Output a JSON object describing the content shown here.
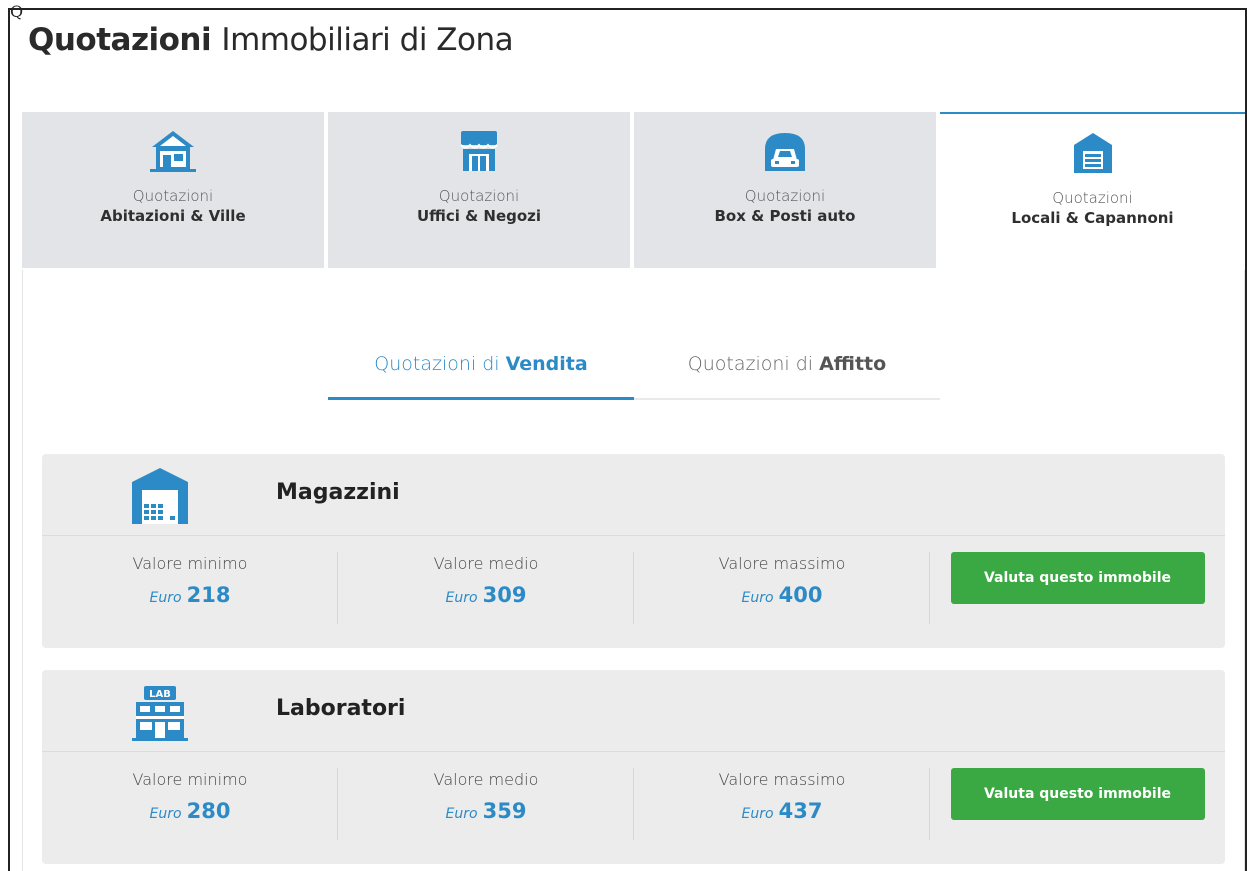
{
  "colors": {
    "accent": "#2c8ac6",
    "button": "#3aa843",
    "tab_inactive": "#e2e4e7",
    "card_bg": "#ececec"
  },
  "page": {
    "title_bold": "Quotazioni",
    "title_light": "Immobiliari di Zona"
  },
  "corner_char": "Q",
  "tabs": [
    {
      "icon": "house-icon",
      "line1": "Quotazioni",
      "line2": "Abitazioni & Ville",
      "active": false
    },
    {
      "icon": "shop-icon",
      "line1": "Quotazioni",
      "line2": "Uffici & Negozi",
      "active": false
    },
    {
      "icon": "garage-car-icon",
      "line1": "Quotazioni",
      "line2": "Box & Posti auto",
      "active": false
    },
    {
      "icon": "warehouse-icon",
      "line1": "Quotazioni",
      "line2": "Locali & Capannoni",
      "active": true
    }
  ],
  "subtabs": [
    {
      "prefix": "Quotazioni di",
      "bold": "Vendita",
      "active": true
    },
    {
      "prefix": "Quotazioni di",
      "bold": "Affitto",
      "active": false
    }
  ],
  "cards": [
    {
      "icon": "warehouse-icon",
      "title": "Magazzini",
      "min_label": "Valore minimo",
      "min_unit": "Euro",
      "min_value": "218",
      "avg_label": "Valore medio",
      "avg_unit": "Euro",
      "avg_value": "309",
      "max_label": "Valore massimo",
      "max_unit": "Euro",
      "max_value": "400",
      "button": "Valuta questo immobile"
    },
    {
      "icon": "lab-building-icon",
      "title": "Laboratori",
      "min_label": "Valore minimo",
      "min_unit": "Euro",
      "min_value": "280",
      "avg_label": "Valore medio",
      "avg_unit": "Euro",
      "avg_value": "359",
      "max_label": "Valore massimo",
      "max_unit": "Euro",
      "max_value": "437",
      "button": "Valuta questo immobile",
      "icon_text": "LAB"
    }
  ]
}
